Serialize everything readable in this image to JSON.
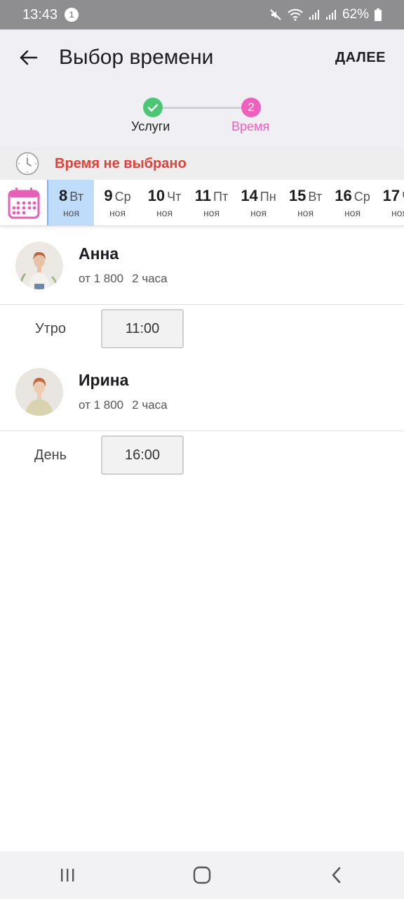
{
  "status_bar": {
    "time": "13:43",
    "notification_count": "1",
    "battery": "62%"
  },
  "header": {
    "title": "Выбор времени",
    "next_label": "ДАЛЕЕ"
  },
  "stepper": {
    "steps": [
      {
        "label": "Услуги",
        "state": "done"
      },
      {
        "label": "Время",
        "number": "2",
        "state": "active"
      }
    ],
    "done_color": "#4cc674",
    "active_color": "#ee5fbe"
  },
  "time_banner": {
    "status": "Время не выбрано",
    "color": "#e0413a"
  },
  "dates": [
    {
      "day": "8",
      "weekday": "Вт",
      "month": "ноя",
      "selected": true
    },
    {
      "day": "9",
      "weekday": "Ср",
      "month": "ноя"
    },
    {
      "day": "10",
      "weekday": "Чт",
      "month": "ноя"
    },
    {
      "day": "11",
      "weekday": "Пт",
      "month": "ноя"
    },
    {
      "day": "14",
      "weekday": "Пн",
      "month": "ноя"
    },
    {
      "day": "15",
      "weekday": "Вт",
      "month": "ноя"
    },
    {
      "day": "16",
      "weekday": "Ср",
      "month": "ноя"
    },
    {
      "day": "17",
      "weekday": "Чт",
      "month": "ноя"
    }
  ],
  "staff": [
    {
      "name": "Анна",
      "price": "от 1 800",
      "duration": "2 часа",
      "slots": [
        {
          "period": "Утро",
          "time": "11:00"
        }
      ]
    },
    {
      "name": "Ирина",
      "price": "от 1 800",
      "duration": "2 часа",
      "slots": [
        {
          "period": "День",
          "time": "16:00"
        }
      ]
    }
  ],
  "icons": {
    "back": "arrow-left-icon",
    "clock": "clock-icon",
    "calendar": "calendar-icon",
    "nav": [
      "recent-apps-icon",
      "home-icon",
      "back-icon"
    ]
  }
}
